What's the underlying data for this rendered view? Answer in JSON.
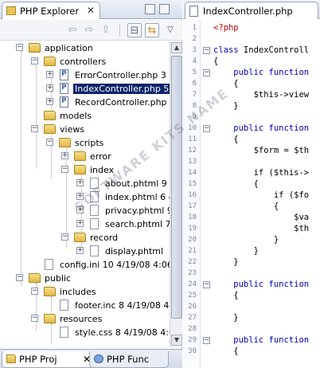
{
  "explorer": {
    "tab_label": "PHP Explorer",
    "close_glyph": "✕",
    "tree": [
      {
        "label": "application",
        "type": "folder",
        "expanded": true
      },
      {
        "label": "controllers",
        "type": "folder",
        "expanded": true
      },
      {
        "label": "ErrorController.php 3",
        "type": "php"
      },
      {
        "label": "IndexController.php 5",
        "type": "php",
        "selected": true
      },
      {
        "label": "RecordController.php",
        "type": "php"
      },
      {
        "label": "models",
        "type": "folder"
      },
      {
        "label": "views",
        "type": "folder",
        "expanded": true
      },
      {
        "label": "scripts",
        "type": "folder",
        "expanded": true
      },
      {
        "label": "error",
        "type": "folder"
      },
      {
        "label": "index",
        "type": "folder",
        "expanded": true
      },
      {
        "label": "about.phtml 9",
        "type": "text"
      },
      {
        "label": "index.phtml 6  4",
        "type": "text"
      },
      {
        "label": "privacy.phtml 9",
        "type": "text"
      },
      {
        "label": "search.phtml 7",
        "type": "text"
      },
      {
        "label": "record",
        "type": "folder",
        "expanded": true
      },
      {
        "label": "display.phtml",
        "type": "text"
      },
      {
        "label": "config.ini 10  4/19/08 4:06 P",
        "type": "text"
      },
      {
        "label": "public",
        "type": "folder",
        "expanded": true
      },
      {
        "label": "includes",
        "type": "folder",
        "expanded": true
      },
      {
        "label": "footer.inc 8  4/19/08 4:",
        "type": "text"
      },
      {
        "label": "resources",
        "type": "folder",
        "expanded": true
      },
      {
        "label": "style.css 8  4/19/08 4:0",
        "type": "text"
      }
    ]
  },
  "bottom_tabs": [
    {
      "label": "PHP Proj",
      "close": "✕"
    },
    {
      "label": "PHP Func"
    }
  ],
  "editor": {
    "tab_label": "IndexController.php",
    "line_numbers": [
      "1",
      "2",
      "3",
      "4",
      "5",
      "6",
      "7",
      "8",
      "9",
      "10",
      "11",
      "12",
      "13",
      "14",
      "15",
      "16",
      "17",
      "18",
      "19",
      "20",
      "21",
      "22",
      "23",
      "24",
      "25",
      "26",
      "27",
      "28",
      "29",
      "30"
    ],
    "code": {
      "l1": "<?php",
      "l3a": "class",
      "l3b": " IndexControll",
      "l4": "{",
      "l5a": "    public",
      "l5b": " function",
      "l6": "    {",
      "l7": "        $this->view",
      "l8": "    }",
      "l10a": "    public",
      "l10b": " function",
      "l11": "    {",
      "l12": "        $form = $th",
      "l14": "        if ($this->",
      "l15": "        {",
      "l16": "            if ($fo",
      "l17": "            {",
      "l18": "                $va",
      "l19": "                $th",
      "l20": "            }",
      "l21": "        }",
      "l22": "    }",
      "l24a": "    public",
      "l24b": " function",
      "l25": "    {",
      "l27": "    }",
      "l29a": "    public",
      "l29b": " function",
      "l30": "    {"
    }
  },
  "watermark": "SOFTWARE KITS NAME"
}
